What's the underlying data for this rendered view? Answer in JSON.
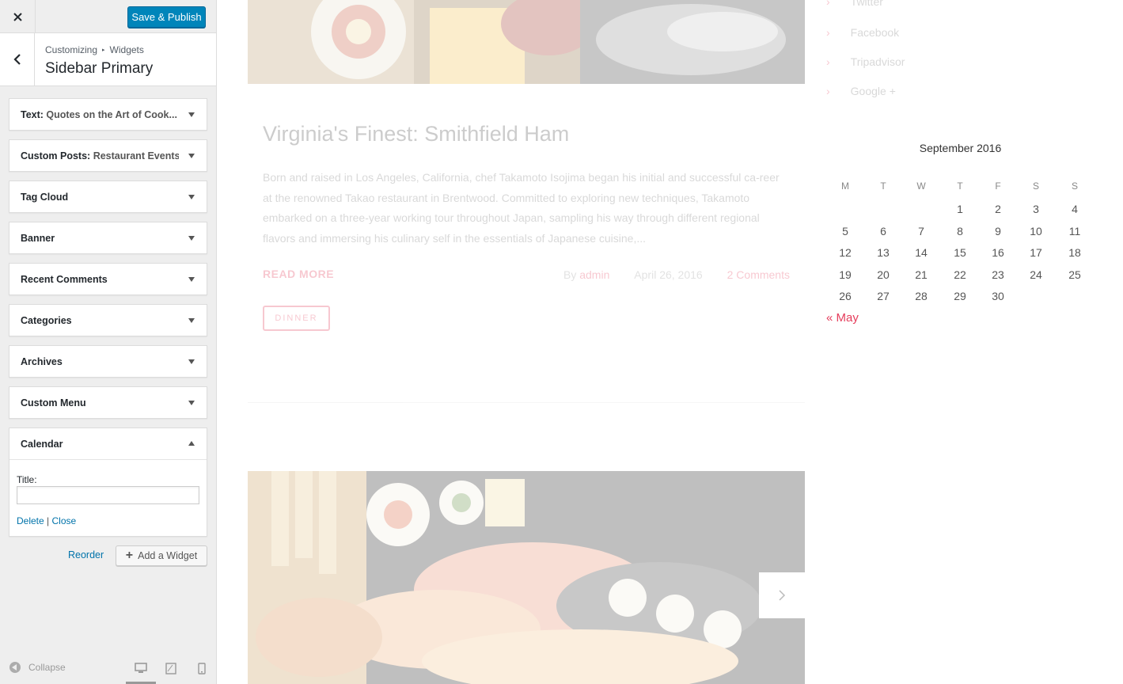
{
  "customizer": {
    "publish_label": "Save & Publish",
    "breadcrumb": [
      "Customizing",
      "Widgets"
    ],
    "breadcrumb_sep": "▸",
    "section_title": "Sidebar Primary",
    "widgets": [
      {
        "title": "Text:",
        "subtitle": "Quotes on the Art of Cook..."
      },
      {
        "title": "Custom Posts:",
        "subtitle": "Restaurant Events"
      },
      {
        "title": "Tag Cloud",
        "subtitle": ""
      },
      {
        "title": "Banner",
        "subtitle": ""
      },
      {
        "title": "Recent Comments",
        "subtitle": ""
      },
      {
        "title": "Categories",
        "subtitle": ""
      },
      {
        "title": "Archives",
        "subtitle": ""
      },
      {
        "title": "Custom Menu",
        "subtitle": ""
      }
    ],
    "calendar_widget": {
      "title": "Calendar",
      "field_label": "Title:",
      "field_value": "",
      "delete_label": "Delete",
      "link_sep": "|",
      "close_label": "Close"
    },
    "reorder_label": "Reorder",
    "add_widget_label": "Add a Widget",
    "collapse_label": "Collapse",
    "accent_color": "#0085ba"
  },
  "preview": {
    "post": {
      "title": "Virginia's Finest: Smithfield Ham",
      "excerpt": "Born and raised in Los Angeles, California, chef Takamoto Isojima began his initial and successful ca-reer at the renowned Takao restaurant in Brentwood. Committed to exploring new techniques, Takamoto embarked on a three-year working tour throughout Japan, sampling his way through different regional flavors and immersing his culinary self in the essentials of Japanese cuisine,...",
      "read_more": "READ MORE",
      "by": "By",
      "author": "admin",
      "date": "April 26, 2016",
      "comments": "2 Comments",
      "tag": "DINNER"
    },
    "social_links": [
      "Twitter",
      "Facebook",
      "Tripadvisor",
      "Google +"
    ],
    "calendar": {
      "caption": "September 2016",
      "weekdays": [
        "M",
        "T",
        "W",
        "T",
        "F",
        "S",
        "S"
      ],
      "weeks": [
        [
          "",
          "",
          "",
          "1",
          "2",
          "3",
          "4"
        ],
        [
          "5",
          "6",
          "7",
          "8",
          "9",
          "10",
          "11"
        ],
        [
          "12",
          "13",
          "14",
          "15",
          "16",
          "17",
          "18"
        ],
        [
          "19",
          "20",
          "21",
          "22",
          "23",
          "24",
          "25"
        ],
        [
          "26",
          "27",
          "28",
          "29",
          "30",
          "",
          ""
        ]
      ],
      "prev_link": "« May"
    },
    "accent_color": "#e53d5b"
  }
}
